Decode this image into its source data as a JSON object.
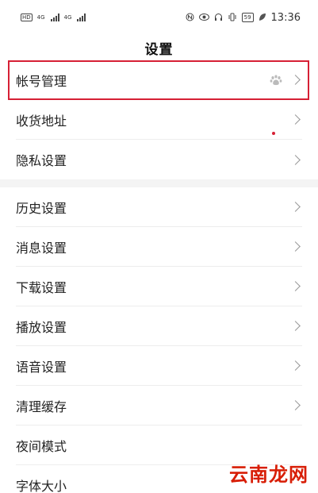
{
  "status_bar": {
    "hd_badge": "HD",
    "network_1": "4G",
    "network_2": "4G",
    "battery_level": "59",
    "time": "13:36",
    "icons": [
      "nfc-icon",
      "eye-icon",
      "headphone-icon",
      "vibrate-icon",
      "battery-icon",
      "leaf-icon"
    ]
  },
  "header": {
    "title": "设置"
  },
  "groups": [
    {
      "items": [
        {
          "label": "帐号管理",
          "icon": "baidu-paw-icon"
        },
        {
          "label": "收货地址"
        },
        {
          "label": "隐私设置"
        }
      ]
    },
    {
      "items": [
        {
          "label": "历史设置"
        },
        {
          "label": "消息设置"
        },
        {
          "label": "下载设置"
        },
        {
          "label": "播放设置"
        },
        {
          "label": "语音设置"
        },
        {
          "label": "清理缓存"
        },
        {
          "label": "夜间模式"
        },
        {
          "label": "字体大小"
        }
      ]
    }
  ],
  "watermark": {
    "text": "云南龙网"
  },
  "colors": {
    "highlight": "#d62035",
    "watermark": "#d81e06"
  }
}
